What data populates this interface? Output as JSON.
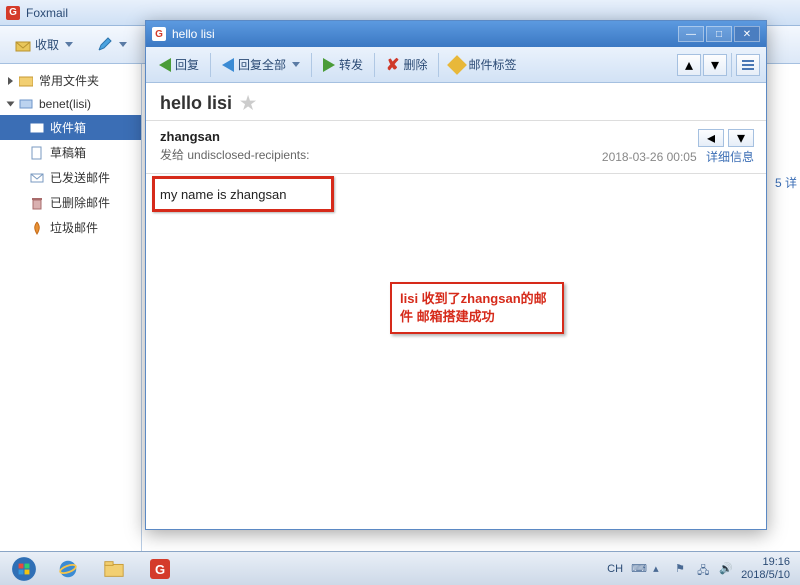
{
  "main": {
    "app_title": "Foxmail",
    "toolbar": {
      "receive": "收取"
    },
    "sidebar": {
      "common_folders": "常用文件夹",
      "account": "benet(lisi)",
      "inbox": "收件箱",
      "drafts": "草稿箱",
      "sent": "已发送邮件",
      "deleted": "已删除邮件",
      "spam": "垃圾邮件"
    },
    "right_label_suffix": "详"
  },
  "msg": {
    "window_title": "hello lisi",
    "toolbar": {
      "reply": "回复",
      "reply_all": "回复全部",
      "forward": "转发",
      "delete": "删除",
      "tags": "邮件标签"
    },
    "subject": "hello lisi",
    "sender": "zhangsan",
    "recipients_label": "发给",
    "recipients": "undisclosed-recipients:",
    "date": "2018-03-26 00:05",
    "details": "详细信息",
    "body": "my name is zhangsan",
    "annotation": "lisi 收到了zhangsan的邮件  邮箱搭建成功"
  },
  "taskbar": {
    "ime": "CH",
    "time": "19:16",
    "date": "2018/5/10"
  }
}
